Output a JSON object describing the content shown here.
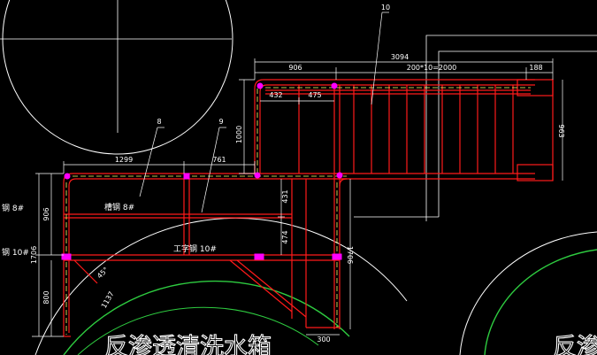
{
  "colors": {
    "background": "#000000",
    "frame": "#ff1a1a",
    "linework": "#ffffff",
    "plate": "#ff00ff",
    "vessel": "#2ecc40",
    "centerline": "#ffff66"
  },
  "dimensions": {
    "top_overall": "3094",
    "top_left": "906",
    "top_middle": "200*10=2000",
    "top_right": "188",
    "inner_left": "432",
    "inner_right": "475",
    "riser_height": "1000",
    "right_height": "963",
    "left_span": "1299",
    "mid_span": "761",
    "left_upper": "906",
    "left_total": "1706",
    "left_lower": "800",
    "center_upper": "431",
    "center_lower": "474",
    "right_lower": "1706",
    "bottom_width": "300",
    "brace_length": "1137",
    "angle": "45°"
  },
  "callouts": {
    "item_8": "8",
    "item_9": "9",
    "item_10": "10"
  },
  "labels": {
    "channel_inner": "槽钢 8#",
    "channel_outer": "钢 8#",
    "ibeam_inner": "工字钢 10#",
    "ibeam_outer": "钢 10#",
    "caption_left": "反渗透清洗水箱",
    "caption_right": "反渗"
  }
}
